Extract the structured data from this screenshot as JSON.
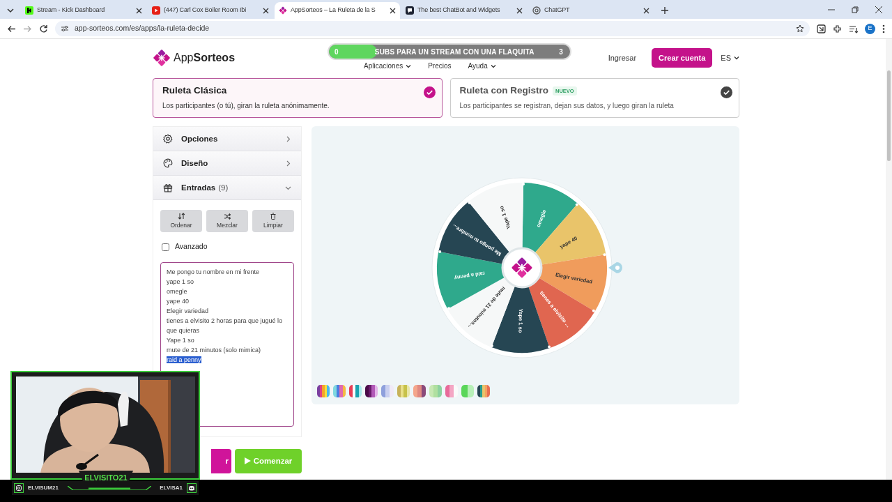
{
  "browser": {
    "tabs": [
      {
        "title": "Stream - Kick Dashboard",
        "selected": false
      },
      {
        "title": "(447) Carl Cox Boiler Room Ibi",
        "selected": false
      },
      {
        "title": "AppSorteos – La Ruleta de la S",
        "selected": true
      },
      {
        "title": "The best ChatBot and Widgets",
        "selected": false
      },
      {
        "title": "ChatGPT",
        "selected": false
      }
    ],
    "url": "app-sorteos.com/es/apps/la-ruleta-decide",
    "profile": "E"
  },
  "header": {
    "logo": "App**Sorteos**",
    "nav": [
      {
        "label": "Aplicaciones",
        "dropdown": true
      },
      {
        "label": "Precios",
        "dropdown": false
      },
      {
        "label": "Ayuda",
        "dropdown": true
      }
    ],
    "login": "Ingresar",
    "signup": "Crear cuenta",
    "language": "ES"
  },
  "goal_overlay": {
    "current": "0",
    "title": "SUBS PARA UN STREAM CON UNA FLAQUITA",
    "target": "3",
    "level": 0.2
  },
  "modes": [
    {
      "title": "Ruleta Clásica",
      "description": "Los participantes (o tú), giran la ruleta anónimamente.",
      "selected": true
    },
    {
      "title": "Ruleta con Registro",
      "badge": "NUEVO",
      "description": "Los participantes se registran, dejan sus datos, y luego giran la ruleta",
      "selected": false
    }
  ],
  "panel": {
    "sections": [
      {
        "label": "Opciones",
        "expanded": false
      },
      {
        "label": "Diseño",
        "expanded": false
      },
      {
        "label": "Entradas",
        "count": "(9)",
        "expanded": true
      }
    ],
    "actions": [
      "Ordenar",
      "Mezclar",
      "Limpiar"
    ],
    "advanced": {
      "label": "Avanzado",
      "checked": false
    },
    "entries": [
      {
        "text": "Me pongo tu nombre en mi frente",
        "selected": false
      },
      {
        "text": "yape 1 so",
        "selected": false
      },
      {
        "text": "omegle",
        "selected": false
      },
      {
        "text": "yape  40",
        "selected": false
      },
      {
        "text": "Elegir variedad",
        "selected": false
      },
      {
        "text": "tienes a elvisito 2 horas para que jugué lo que quieras",
        "selected": false
      },
      {
        "text": "Yape 1 so",
        "selected": false
      },
      {
        "text": "mute de 21 minutos (solo mimica)",
        "selected": false
      },
      {
        "text": "raid a penny",
        "selected": true
      }
    ]
  },
  "buttons": [
    {
      "label": "r",
      "kind": "spin"
    },
    {
      "label": "Comenzar",
      "kind": "start"
    }
  ],
  "wheel": {
    "slices": [
      {
        "label": "omegle",
        "color": "#2fa98c"
      },
      {
        "label": "yape  40",
        "color": "#e9c46a"
      },
      {
        "label": "Elegir variedad",
        "color": "#f09c5c"
      },
      {
        "label": "tienes a elvisito ...",
        "color": "#e06650"
      },
      {
        "label": "Yape 1 so",
        "color": "#264653"
      },
      {
        "label": "mute de 21 minutos...",
        "color": "#f6f8f8"
      },
      {
        "label": "raid a penny",
        "color": "#2fa98c"
      },
      {
        "label": "Me pongo tu nombre...",
        "color": "#264653"
      },
      {
        "label": "Yape 1 so",
        "color": "#f6f8f8"
      }
    ]
  },
  "webcam": {
    "name": "ELVISITO21",
    "instagram": "ELVISUM21",
    "discord": "ELVISA1"
  }
}
